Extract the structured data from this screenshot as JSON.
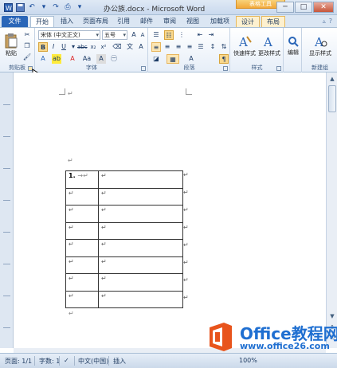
{
  "window": {
    "title": "办公族.docx - Microsoft Word",
    "context_group": "表格工具",
    "minimize": "─",
    "maximize": "□",
    "close": "✕"
  },
  "tabs": [
    {
      "label": "文件"
    },
    {
      "label": "开始"
    },
    {
      "label": "插入"
    },
    {
      "label": "页面布局"
    },
    {
      "label": "引用"
    },
    {
      "label": "邮件"
    },
    {
      "label": "审阅"
    },
    {
      "label": "视图"
    },
    {
      "label": "加载项"
    },
    {
      "label": "设计"
    },
    {
      "label": "布局"
    }
  ],
  "ribbon": {
    "clipboard": {
      "paste_label": "粘贴",
      "group_label": "剪贴板"
    },
    "font": {
      "font_name": "宋体 (中文正文)",
      "font_size": "五号",
      "group_label": "字体"
    },
    "paragraph": {
      "group_label": "段落"
    },
    "styles": {
      "quick_styles": "快速样式",
      "change_styles": "更改样式",
      "group_label": "样式"
    },
    "editing": {
      "edit_label": "编辑"
    },
    "new_group": {
      "show_styles": "显示样式",
      "group_label": "新建组"
    }
  },
  "document": {
    "paragraph_mark": "↵",
    "table": {
      "rows": 8,
      "first_cell": "1.",
      "first_cell_tab": "→"
    }
  },
  "statusbar": {
    "page": "页面: 1/1",
    "words": "字数: 1",
    "language": "中文(中国)",
    "mode": "插入",
    "zoom": "100%"
  },
  "watermark": {
    "brand": "Office教程网",
    "url": "www.office26.com"
  },
  "colors": {
    "file_tab": "#2a66b8",
    "context_tab": "#f2a93a",
    "watermark": "#1f6fd1"
  }
}
